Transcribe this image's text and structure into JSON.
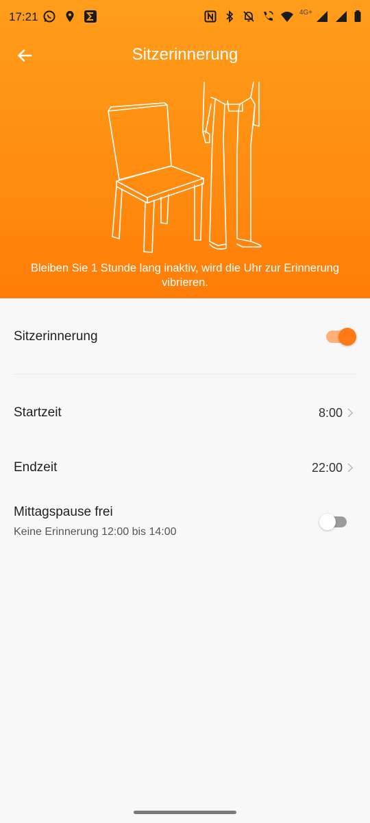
{
  "status_bar": {
    "time": "17:21",
    "left_icons": [
      "whatsapp-icon",
      "location-pin-icon",
      "sigma-app-icon"
    ],
    "right_icons": [
      "nfc-icon",
      "bluetooth-icon",
      "mute-bell-icon",
      "wifi-call-icon",
      "wifi-icon",
      "cell-signal-icon",
      "cell-signal-icon",
      "battery-icon"
    ],
    "network_label": "4G+"
  },
  "header": {
    "title": "Sitzerinnerung",
    "back_icon": "arrow-left-icon",
    "description": "Bleiben Sie 1 Stunde lang inaktiv, wird die Uhr zur Erinnerung vibrieren.",
    "gradient": [
      "#ff9d1a",
      "#ff7d08"
    ]
  },
  "settings": {
    "sit_reminder": {
      "label": "Sitzerinnerung",
      "enabled": true
    },
    "start_time": {
      "label": "Startzeit",
      "value": "8:00"
    },
    "end_time": {
      "label": "Endzeit",
      "value": "22:00"
    },
    "lunch_break": {
      "label": "Mittagspause frei",
      "sublabel": "Keine Erinnerung 12:00 bis 14:00",
      "enabled": false
    }
  },
  "colors": {
    "accent": "#ff7a14",
    "accent_light": "#ffb07a"
  }
}
